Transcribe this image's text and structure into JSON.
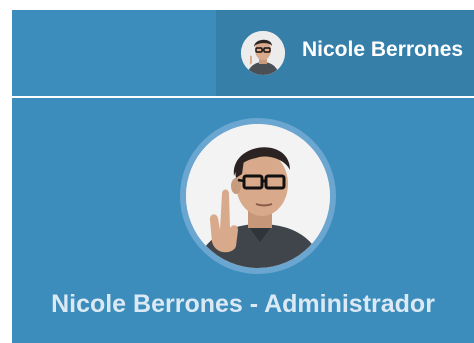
{
  "navbar": {
    "user_name": "Nicole Berrones",
    "avatar_icon": "user-avatar-photo"
  },
  "user_header": {
    "title": "Nicole Berrones - Administrador",
    "avatar_icon": "user-avatar-photo"
  },
  "colors": {
    "navbar_bg": "#3c8dbc",
    "user_menu_bg": "#367fa9",
    "text_light": "#dbe9f4",
    "avatar_ring": "#6aa6cf"
  }
}
